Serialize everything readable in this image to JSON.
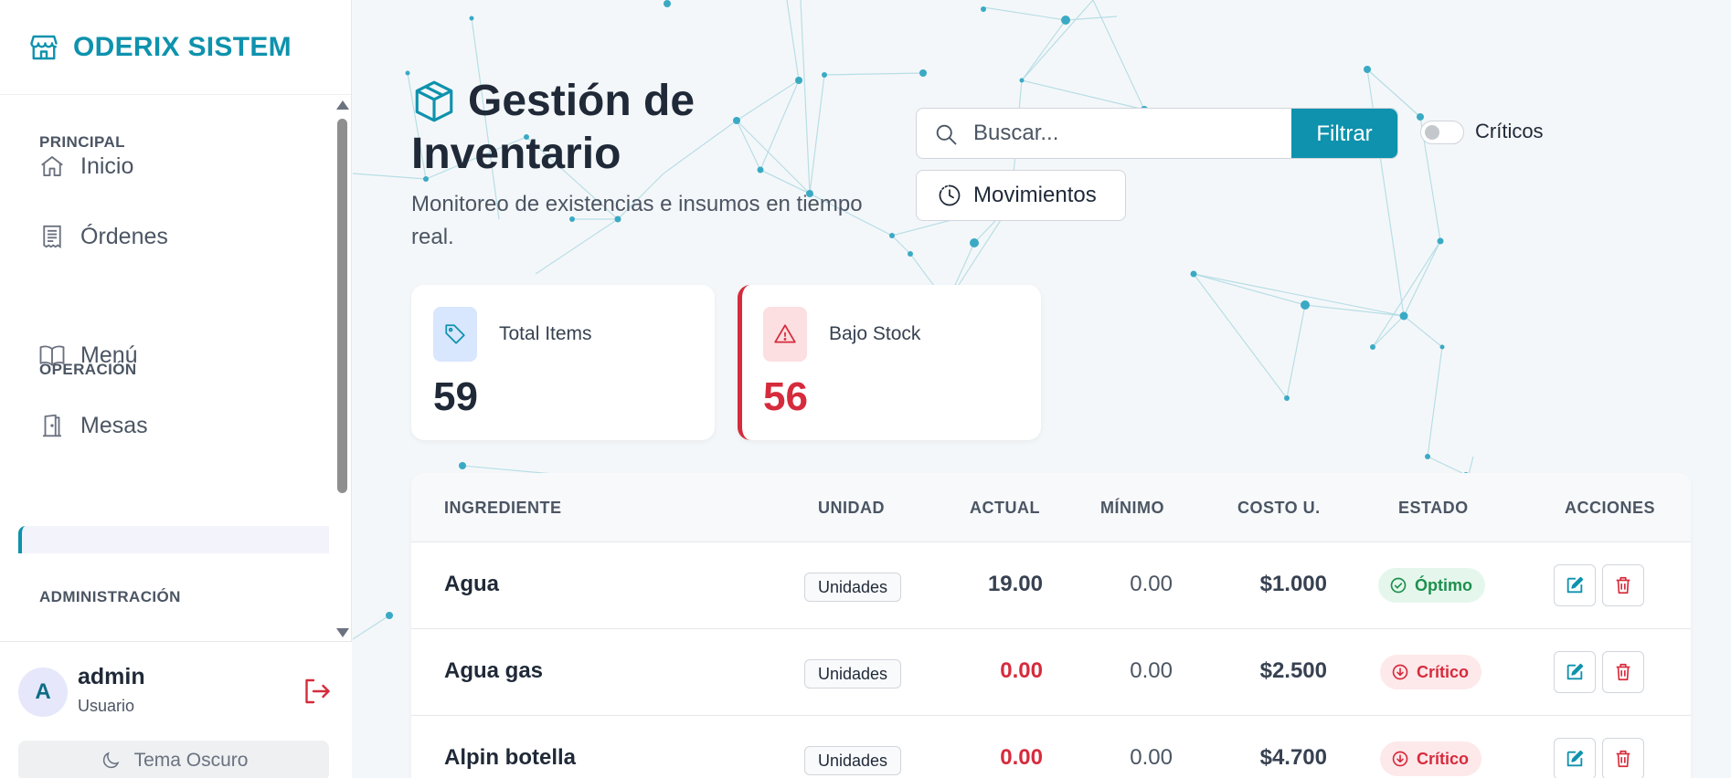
{
  "brand": {
    "name": "ODERIX SISTEM"
  },
  "nav": {
    "sections": [
      {
        "label": "PRINCIPAL"
      },
      {
        "label": "OPERACIÓN"
      },
      {
        "label": "ADMINISTRACIÓN"
      }
    ],
    "items": [
      {
        "label": "Inicio",
        "icon": "home-icon"
      },
      {
        "label": "Órdenes",
        "icon": "receipt-icon"
      },
      {
        "label": "Menú",
        "icon": "book-icon"
      },
      {
        "label": "Mesas",
        "icon": "door-icon"
      }
    ]
  },
  "user": {
    "initial": "A",
    "name": "admin",
    "role": "Usuario"
  },
  "theme": {
    "label": "Tema Oscuro"
  },
  "header": {
    "title": "Gestión de Inventario",
    "subtitle": "Monitoreo de existencias e insumos en tiempo real."
  },
  "search": {
    "placeholder": "Buscar...",
    "filter_label": "Filtrar"
  },
  "toggle": {
    "label": "Críticos",
    "checked": false
  },
  "movements": {
    "label": "Movimientos"
  },
  "stats": {
    "total": {
      "label": "Total Items",
      "value": "59"
    },
    "low": {
      "label": "Bajo Stock",
      "value": "56"
    }
  },
  "table": {
    "headers": [
      "INGREDIENTE",
      "UNIDAD",
      "ACTUAL",
      "MÍNIMO",
      "COSTO U.",
      "ESTADO",
      "ACCIONES"
    ],
    "rows": [
      {
        "name": "Agua",
        "unit": "Unidades",
        "actual": "19.00",
        "min": "0.00",
        "cost": "$1.000",
        "status": "Óptimo",
        "critical": false
      },
      {
        "name": "Agua gas",
        "unit": "Unidades",
        "actual": "0.00",
        "min": "0.00",
        "cost": "$2.500",
        "status": "Crítico",
        "critical": true
      },
      {
        "name": "Alpin botella",
        "unit": "Unidades",
        "actual": "0.00",
        "min": "0.00",
        "cost": "$4.700",
        "status": "Crítico",
        "critical": true
      }
    ]
  },
  "colors": {
    "accent": "#0e92ad",
    "critical": "#d62b3c",
    "ok": "#1e8f4e"
  }
}
